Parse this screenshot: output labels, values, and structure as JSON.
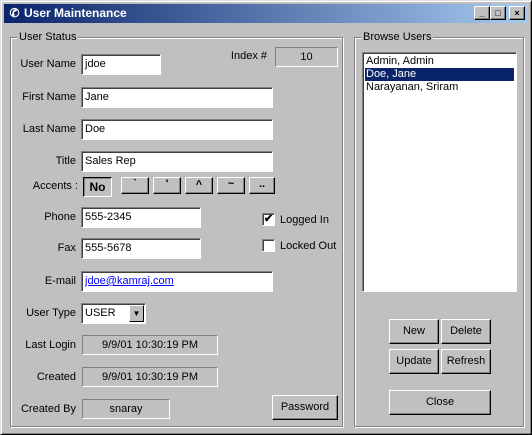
{
  "window": {
    "title": "User Maintenance",
    "minimize_glyph": "_",
    "maximize_glyph": "□",
    "close_glyph": "×"
  },
  "user_status": {
    "group_label": "User Status",
    "index_label": "Index #",
    "index_value": "10",
    "username_label": "User Name",
    "username_value": "jdoe",
    "first_name_label": "First Name",
    "first_name_value": "Jane",
    "last_name_label": "Last Name",
    "last_name_value": "Doe",
    "title_label": "Title",
    "title_value": "Sales Rep",
    "accents_label": "Accents :",
    "accent_buttons": [
      "No",
      "`",
      "'",
      "^",
      "~",
      ".."
    ],
    "phone_label": "Phone",
    "phone_value": "555-2345",
    "fax_label": "Fax",
    "fax_value": "555-5678",
    "email_label": "E-mail",
    "email_value": "jdoe@kamraj.com",
    "logged_in_label": "Logged In",
    "logged_in_checked": true,
    "locked_out_label": "Locked Out",
    "locked_out_checked": false,
    "user_type_label": "User Type",
    "user_type_value": "USER",
    "last_login_label": "Last Login",
    "last_login_value": "9/9/01 10:30:19 PM",
    "created_label": "Created",
    "created_value": "9/9/01 10:30:19 PM",
    "created_by_label": "Created By",
    "created_by_value": "snaray",
    "password_button": "Password"
  },
  "browse_users": {
    "group_label": "Browse Users",
    "users": [
      "Admin, Admin",
      "Doe, Jane",
      "Narayanan, Sriram"
    ],
    "selected_index": 1,
    "new_button": "New",
    "delete_button": "Delete",
    "update_button": "Update",
    "refresh_button": "Refresh",
    "close_button": "Close"
  },
  "colors": {
    "title_bar_start": "#0a246a",
    "title_bar_end": "#a6caf0",
    "window_bg": "#c0c0c0",
    "selection_bg": "#0a246a",
    "link": "#0000ff"
  },
  "icons": {
    "app": "user-maintenance-app-icon",
    "checkmark": "✔",
    "dropdown_arrow": "▼"
  }
}
